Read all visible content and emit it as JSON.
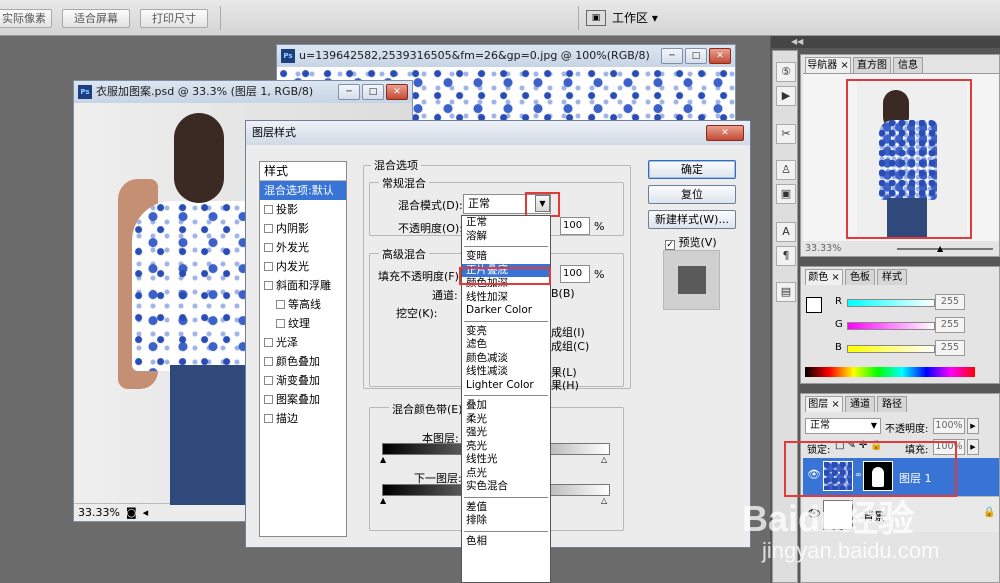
{
  "options_bar": {
    "actual_pixels": "实际像素",
    "fit_screen": "适合屏幕",
    "print_size": "打印尺寸",
    "workspace": "工作区 ▾"
  },
  "win_back": {
    "title": "u=139642582,2539316505&fm=26&gp=0.jpg @ 100%(RGB/8)"
  },
  "win_front": {
    "title": "衣服加图案.psd @ 33.3% (图层 1, RGB/8)",
    "zoom": "33.33%"
  },
  "dialog": {
    "title": "图层样式",
    "style_header": "样式",
    "styles": [
      {
        "label": "混合选项:默认",
        "checkbox": false,
        "selected": true,
        "indent": false
      },
      {
        "label": "投影",
        "checkbox": true,
        "selected": false,
        "indent": false
      },
      {
        "label": "内阴影",
        "checkbox": true,
        "selected": false,
        "indent": false
      },
      {
        "label": "外发光",
        "checkbox": true,
        "selected": false,
        "indent": false
      },
      {
        "label": "内发光",
        "checkbox": true,
        "selected": false,
        "indent": false
      },
      {
        "label": "斜面和浮雕",
        "checkbox": true,
        "selected": false,
        "indent": false
      },
      {
        "label": "等高线",
        "checkbox": true,
        "selected": false,
        "indent": true
      },
      {
        "label": "纹理",
        "checkbox": true,
        "selected": false,
        "indent": true
      },
      {
        "label": "光泽",
        "checkbox": true,
        "selected": false,
        "indent": false
      },
      {
        "label": "颜色叠加",
        "checkbox": true,
        "selected": false,
        "indent": false
      },
      {
        "label": "渐变叠加",
        "checkbox": true,
        "selected": false,
        "indent": false
      },
      {
        "label": "图案叠加",
        "checkbox": true,
        "selected": false,
        "indent": false
      },
      {
        "label": "描边",
        "checkbox": true,
        "selected": false,
        "indent": false
      }
    ],
    "blend_options": "混合选项",
    "general_blending": "常规混合",
    "blend_mode_label": "混合模式(D):",
    "blend_mode_value": "正常",
    "opacity_label": "不透明度(O):",
    "opacity_value": "100",
    "pct": "%",
    "advanced_blending": "高级混合",
    "fill_opacity_label": "填充不透明度(F):",
    "fill_opacity_value": "100",
    "channels_label": "通道:",
    "channel_b": "B(B)",
    "knockout_label": "挖空(K):",
    "group_i": "成组(I)",
    "group_c": "成组(C)",
    "opt_l": "果(L)",
    "opt_h": "果(H)",
    "blend_if_label": "混合颜色带(E):",
    "this_layer": "本图层:",
    "underlying_layer": "下一图层:",
    "ok": "确定",
    "reset": "复位",
    "new_style": "新建样式(W)...",
    "preview": "预览(V)"
  },
  "dropdown": {
    "groups": [
      [
        "正常",
        "溶解"
      ],
      [
        "变暗",
        "正片叠底",
        "颜色加深",
        "线性加深",
        "Darker Color"
      ],
      [
        "变亮",
        "滤色",
        "颜色减淡",
        "线性减淡",
        "Lighter Color"
      ],
      [
        "叠加",
        "柔光",
        "强光",
        "亮光",
        "线性光",
        "点光",
        "实色混合"
      ],
      [
        "差值",
        "排除"
      ],
      [
        "色相"
      ]
    ],
    "highlight": "正片叠底"
  },
  "navigator": {
    "tabs": [
      "导航器",
      "直方图",
      "信息"
    ],
    "zoom": "33.33%"
  },
  "color_panel": {
    "tabs": [
      "颜色",
      "色板",
      "样式"
    ],
    "channels": [
      {
        "name": "R",
        "value": "255"
      },
      {
        "name": "G",
        "value": "255"
      },
      {
        "name": "B",
        "value": "255"
      }
    ]
  },
  "layers_panel": {
    "tabs": [
      "图层",
      "通道",
      "路径"
    ],
    "mode": "正常",
    "opacity_label": "不透明度:",
    "opacity": "100%",
    "lock_label": "锁定:",
    "fill_label": "填充:",
    "fill": "100%",
    "layers": [
      {
        "name": "图层 1",
        "selected": true
      },
      {
        "name": "背景",
        "selected": false
      }
    ]
  },
  "watermark": {
    "brand": "Baidu经验",
    "url": "jingyan.baidu.com"
  }
}
